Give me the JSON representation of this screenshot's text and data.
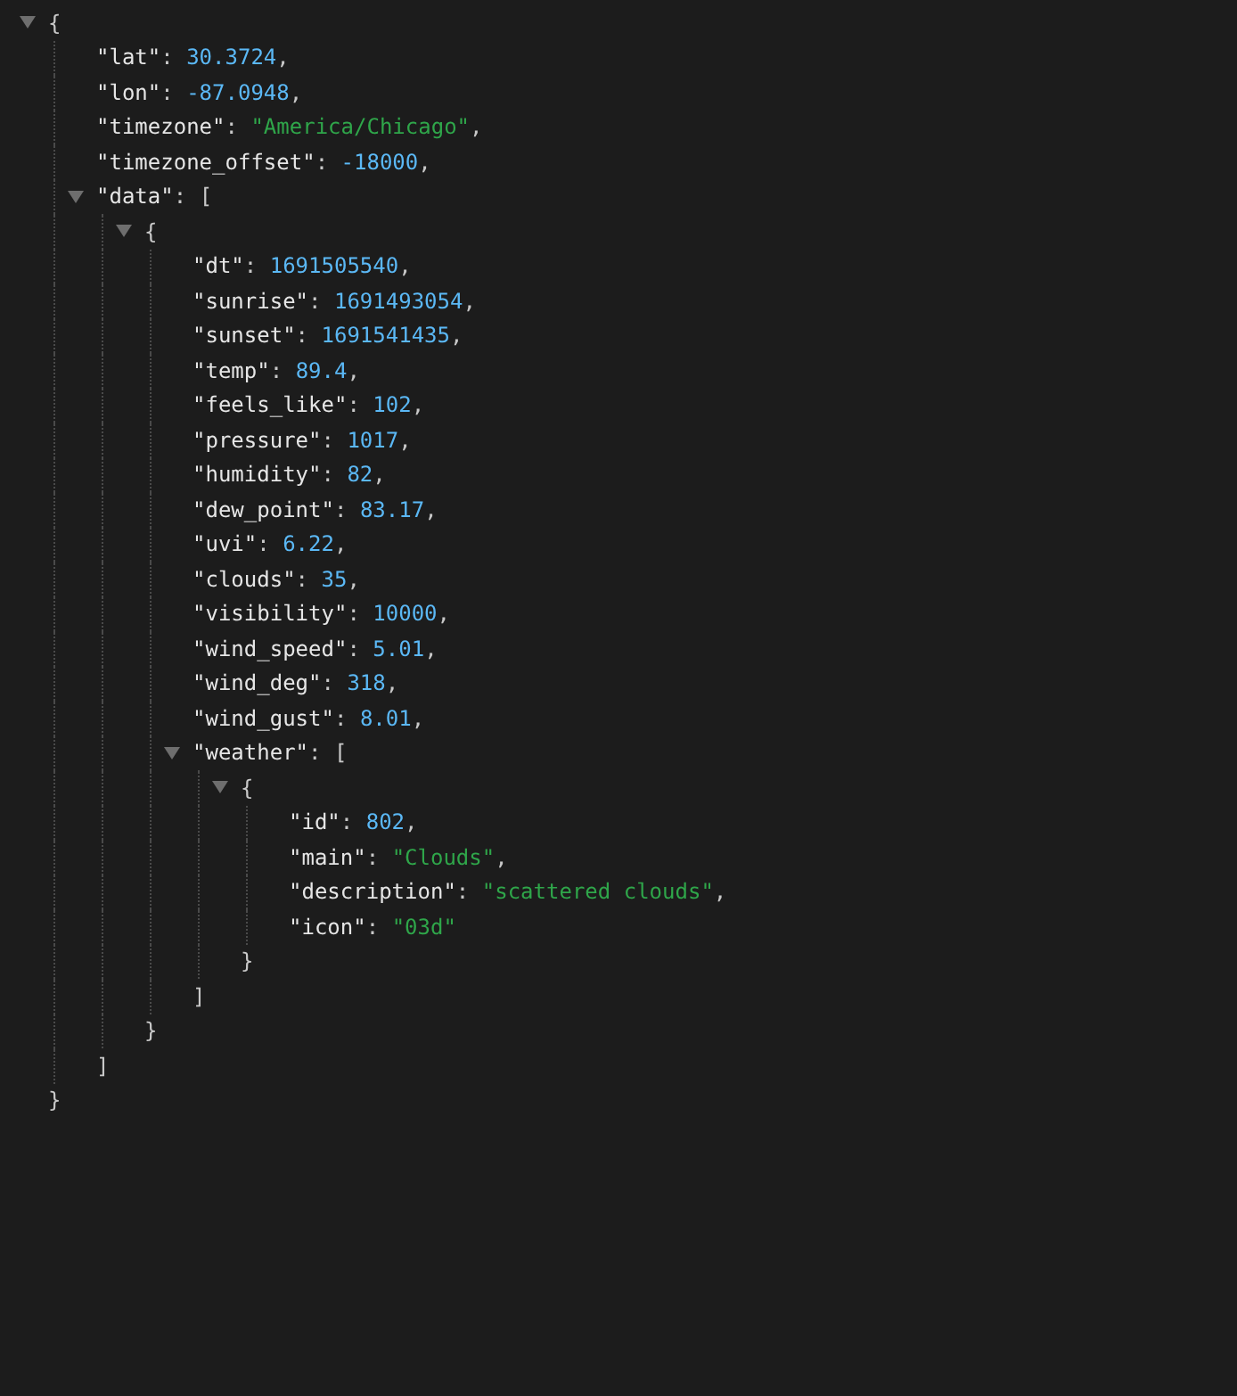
{
  "root": {
    "open": "{",
    "close": "}",
    "expanded": true,
    "children": [
      {
        "key": "\"lat\"",
        "sep": ": ",
        "value": "30.3724",
        "kind": "number",
        "punct": ","
      },
      {
        "key": "\"lon\"",
        "sep": ": ",
        "value": "-87.0948",
        "kind": "number",
        "punct": ","
      },
      {
        "key": "\"timezone\"",
        "sep": ": ",
        "value": "\"America/Chicago\"",
        "kind": "string",
        "punct": ","
      },
      {
        "key": "\"timezone_offset\"",
        "sep": ": ",
        "value": "-18000",
        "kind": "number",
        "punct": ","
      },
      {
        "key": "\"data\"",
        "sep": ": ",
        "open": "[",
        "close": "]",
        "expanded": true,
        "children": [
          {
            "open": "{",
            "close": "}",
            "expanded": true,
            "children": [
              {
                "key": "\"dt\"",
                "sep": ": ",
                "value": "1691505540",
                "kind": "number",
                "punct": ","
              },
              {
                "key": "\"sunrise\"",
                "sep": ": ",
                "value": "1691493054",
                "kind": "number",
                "punct": ","
              },
              {
                "key": "\"sunset\"",
                "sep": ": ",
                "value": "1691541435",
                "kind": "number",
                "punct": ","
              },
              {
                "key": "\"temp\"",
                "sep": ": ",
                "value": "89.4",
                "kind": "number",
                "punct": ","
              },
              {
                "key": "\"feels_like\"",
                "sep": ": ",
                "value": "102",
                "kind": "number",
                "punct": ","
              },
              {
                "key": "\"pressure\"",
                "sep": ": ",
                "value": "1017",
                "kind": "number",
                "punct": ","
              },
              {
                "key": "\"humidity\"",
                "sep": ": ",
                "value": "82",
                "kind": "number",
                "punct": ","
              },
              {
                "key": "\"dew_point\"",
                "sep": ": ",
                "value": "83.17",
                "kind": "number",
                "punct": ","
              },
              {
                "key": "\"uvi\"",
                "sep": ": ",
                "value": "6.22",
                "kind": "number",
                "punct": ","
              },
              {
                "key": "\"clouds\"",
                "sep": ": ",
                "value": "35",
                "kind": "number",
                "punct": ","
              },
              {
                "key": "\"visibility\"",
                "sep": ": ",
                "value": "10000",
                "kind": "number",
                "punct": ","
              },
              {
                "key": "\"wind_speed\"",
                "sep": ": ",
                "value": "5.01",
                "kind": "number",
                "punct": ","
              },
              {
                "key": "\"wind_deg\"",
                "sep": ": ",
                "value": "318",
                "kind": "number",
                "punct": ","
              },
              {
                "key": "\"wind_gust\"",
                "sep": ": ",
                "value": "8.01",
                "kind": "number",
                "punct": ","
              },
              {
                "key": "\"weather\"",
                "sep": ": ",
                "open": "[",
                "close": "]",
                "expanded": true,
                "children": [
                  {
                    "open": "{",
                    "close": "}",
                    "expanded": true,
                    "children": [
                      {
                        "key": "\"id\"",
                        "sep": ": ",
                        "value": "802",
                        "kind": "number",
                        "punct": ","
                      },
                      {
                        "key": "\"main\"",
                        "sep": ": ",
                        "value": "\"Clouds\"",
                        "kind": "string",
                        "punct": ","
                      },
                      {
                        "key": "\"description\"",
                        "sep": ": ",
                        "value": "\"scattered clouds\"",
                        "kind": "string",
                        "punct": ","
                      },
                      {
                        "key": "\"icon\"",
                        "sep": ": ",
                        "value": "\"03d\"",
                        "kind": "string"
                      }
                    ]
                  }
                ]
              }
            ]
          }
        ]
      }
    ]
  }
}
